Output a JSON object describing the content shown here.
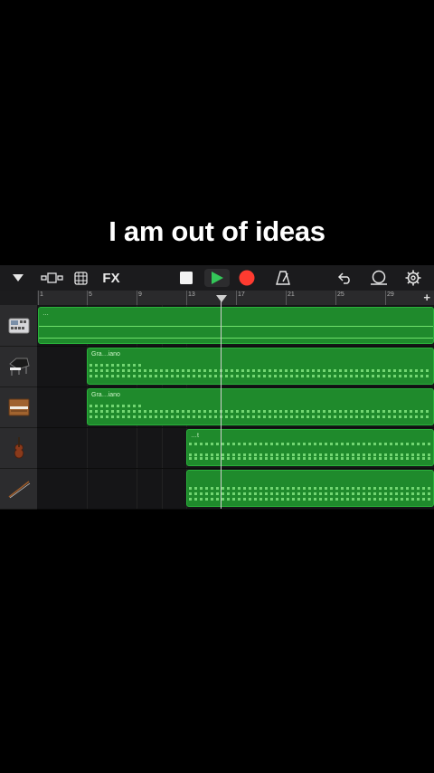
{
  "caption": "I am out of ideas",
  "toolbar": {
    "menu_icon": "chevron-down-icon",
    "view_icon": "tracks-view-icon",
    "mixer_icon": "grid-icon",
    "fx_label": "FX",
    "stop_icon": "stop-icon",
    "play_icon": "play-icon",
    "record_icon": "record-icon",
    "metronome_icon": "metronome-icon",
    "undo_icon": "undo-icon",
    "loop_icon": "loop-icon",
    "settings_icon": "gear-icon",
    "play_color": "#34c759",
    "record_color": "#ff3b30"
  },
  "ruler": {
    "bars": [
      "1",
      "5",
      "9",
      "13",
      "17",
      "21",
      "25",
      "29"
    ],
    "add_label": "+"
  },
  "tracks": [
    {
      "instrument": "drum-machine-icon",
      "regions": [
        {
          "name": "…"
        }
      ]
    },
    {
      "instrument": "grand-piano-icon",
      "regions": [
        {
          "name": "Gra…iano"
        }
      ]
    },
    {
      "instrument": "upright-piano-icon",
      "regions": [
        {
          "name": "Gra…iano"
        }
      ]
    },
    {
      "instrument": "violin-icon",
      "regions": [
        {
          "name": "…t"
        }
      ]
    },
    {
      "instrument": "bow-icon",
      "regions": [
        {
          "name": ""
        }
      ]
    }
  ],
  "colors": {
    "region_green": "#1f8a2c",
    "background": "#000000"
  }
}
